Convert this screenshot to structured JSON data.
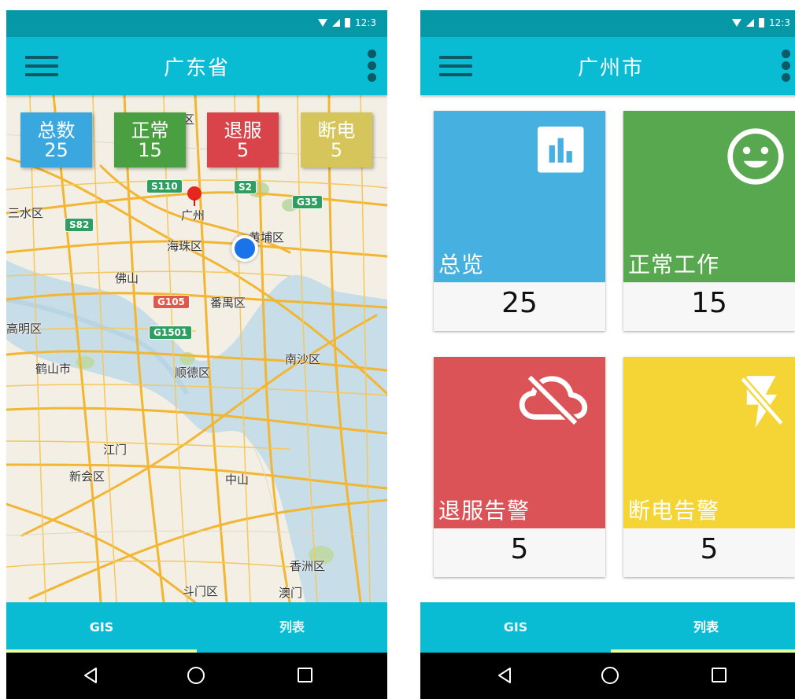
{
  "status_bar": {
    "time": "12:3"
  },
  "left_screen": {
    "title": "广东省",
    "stats": [
      {
        "label": "总数",
        "value": "25",
        "color": "#3aa8de"
      },
      {
        "label": "正常",
        "value": "15",
        "color": "#4aa040"
      },
      {
        "label": "退服",
        "value": "5",
        "color": "#d9444a"
      },
      {
        "label": "断电",
        "value": "5",
        "color": "#d5c55a"
      }
    ],
    "map_labels": {
      "huadu": "花都区",
      "sanshui": "三水区",
      "guangzhou": "广州",
      "haizhu": "海珠区",
      "huangpu": "黄埔区",
      "foshan": "佛山",
      "panyu": "番禺区",
      "gaoming": "高明区",
      "heshan": "鹤山市",
      "shunde": "顺德区",
      "nansha": "南沙区",
      "jiangmen": "江门",
      "xinhui": "新会区",
      "zhongshan": "中山",
      "xiangzhou": "香洲区",
      "doumen": "斗门区",
      "macau": "澳门"
    },
    "roads": {
      "s110": "S110",
      "s2": "S2",
      "g35": "G35",
      "s82": "S82",
      "g105": "G105",
      "g1501": "G1501"
    },
    "tabs": {
      "gis": "GIS",
      "list": "列表"
    },
    "active_tab": "GIS"
  },
  "right_screen": {
    "title": "广州市",
    "cards": [
      {
        "label": "总览",
        "value": "25",
        "color": "#46b1e1",
        "icon": "bar-chart-icon"
      },
      {
        "label": "正常工作",
        "value": "15",
        "color": "#58a84f",
        "icon": "smiley-icon"
      },
      {
        "label": "退服告警",
        "value": "5",
        "color": "#db5257",
        "icon": "cloud-off-icon"
      },
      {
        "label": "断电告警",
        "value": "5",
        "color": "#f5d535",
        "icon": "flash-off-icon"
      }
    ],
    "tabs": {
      "gis": "GIS",
      "list": "列表"
    },
    "active_tab": "列表"
  }
}
